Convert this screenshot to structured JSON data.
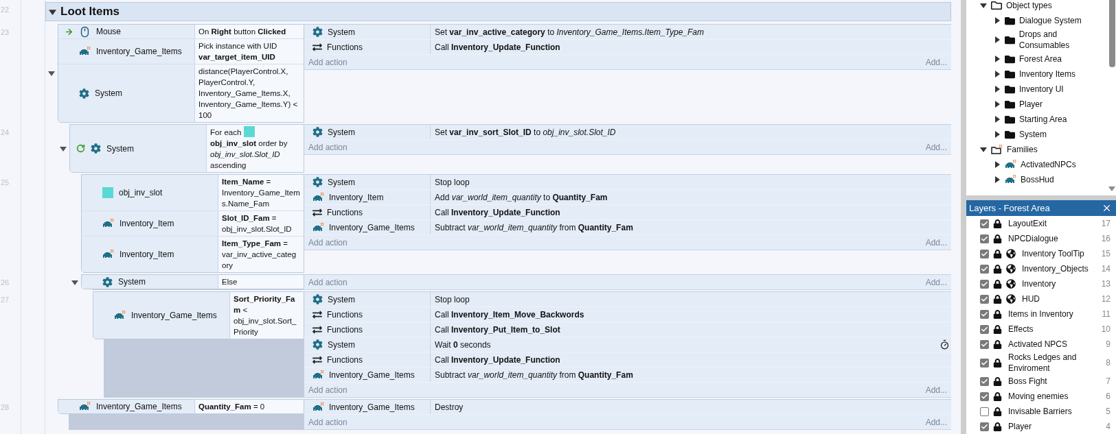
{
  "group": {
    "line": "22",
    "title": "Loot Items",
    "expanded": true,
    "events": [
      {
        "line": "23",
        "expanded": true,
        "trigger": true,
        "loop": false,
        "conditions": [
          {
            "kind": "mouse",
            "object": "Mouse",
            "text": "On **Right** button **Clicked**"
          },
          {
            "kind": "sprite",
            "object": "Inventory_Game_Items",
            "text": "Pick instance with UID **var_target_item_UID**"
          },
          {
            "kind": "system",
            "object": "System",
            "text": "distance(PlayerControl.X, PlayerControl.Y, Inventory_Game_Items.X, Inventory_Game_Items.Y) < 100"
          }
        ],
        "actions": [
          {
            "kind": "system",
            "object": "System",
            "text": "Set **var_inv_active_category** to *Inventory_Game_Items.Item_Type_Fam*"
          },
          {
            "kind": "functions",
            "object": "Functions",
            "text": "Call **Inventory_Update_Function**"
          }
        ],
        "add_action": "Add action",
        "add_more": "Add...",
        "children": [
          {
            "line": "24",
            "expanded": true,
            "trigger": false,
            "loop": true,
            "conditions": [
              {
                "kind": "foreach",
                "object": "System",
                "lead": "For each",
                "text": "**obj_inv_slot** order by *obj_inv_slot.Slot_ID* ascending"
              }
            ],
            "actions": [
              {
                "kind": "system",
                "object": "System",
                "text": "Set **var_inv_sort_Slot_ID** to *obj_inv_slot.Slot_ID*"
              }
            ],
            "add_action": "Add action",
            "add_more": "Add...",
            "children": [
              {
                "line": "25",
                "trigger": false,
                "loop": false,
                "conditions": [
                  {
                    "kind": "swatch",
                    "object": "obj_inv_slot",
                    "text": "**Item_Name** = Inventory_Game_Items.Name_Fam"
                  },
                  {
                    "kind": "sprite",
                    "object": "Inventory_Item",
                    "text": "**Slot_ID_Fam** = obj_inv_slot.Slot_ID"
                  },
                  {
                    "kind": "sprite",
                    "object": "Inventory_Item",
                    "text": "**Item_Type_Fam** = var_inv_active_category"
                  }
                ],
                "actions": [
                  {
                    "kind": "system",
                    "object": "System",
                    "text": "Stop loop"
                  },
                  {
                    "kind": "sprite",
                    "object": "Inventory_Item",
                    "text": "Add *var_world_item_quantity* to **Quantity_Fam**"
                  },
                  {
                    "kind": "functions",
                    "object": "Functions",
                    "text": "Call **Inventory_Update_Function**"
                  },
                  {
                    "kind": "sprite",
                    "object": "Inventory_Game_Items",
                    "text": "Subtract *var_world_item_quantity* from **Quantity_Fam**"
                  }
                ],
                "add_action": "Add action",
                "add_more": "Add..."
              },
              {
                "line": "26",
                "expanded": true,
                "trigger": false,
                "loop": false,
                "conditions": [
                  {
                    "kind": "system",
                    "object": "System",
                    "text": "Else"
                  }
                ],
                "add_action": "Add action",
                "add_more": "Add...",
                "children": [
                  {
                    "line": "27",
                    "trigger": false,
                    "loop": false,
                    "conditions": [
                      {
                        "kind": "sprite",
                        "object": "Inventory_Game_Items",
                        "text": "**Sort_Priority_Fam** < obj_inv_slot.Sort_Priority"
                      }
                    ],
                    "actions": [
                      {
                        "kind": "system",
                        "object": "System",
                        "text": "Stop loop"
                      },
                      {
                        "kind": "functions",
                        "object": "Functions",
                        "text": "Call **Inventory_Item_Move_Backwords**"
                      },
                      {
                        "kind": "functions",
                        "object": "Functions",
                        "text": "Call **Inventory_Put_Item_to_Slot**"
                      },
                      {
                        "kind": "wait",
                        "object": "System",
                        "text": "Wait **0** seconds"
                      },
                      {
                        "kind": "functions",
                        "object": "Functions",
                        "text": "Call **Inventory_Update_Function**"
                      },
                      {
                        "kind": "sprite",
                        "object": "Inventory_Game_Items",
                        "text": "Subtract *var_world_item_quantity* from **Quantity_Fam**"
                      }
                    ],
                    "add_action": "Add action",
                    "add_more": "Add..."
                  }
                ]
              }
            ]
          }
        ]
      },
      {
        "line": "28",
        "trigger": false,
        "loop": false,
        "conditions": [
          {
            "kind": "sprite",
            "object": "Inventory_Game_Items",
            "text": "**Quantity_Fam** = 0"
          }
        ],
        "actions": [
          {
            "kind": "sprite",
            "object": "Inventory_Game_Items",
            "text": "Destroy"
          }
        ],
        "add_action": "Add action",
        "add_more": "Add..."
      }
    ]
  },
  "project_tree": [
    {
      "label": "Object types",
      "kind": "folder",
      "expanded": true,
      "children": [
        {
          "label": "Dialogue System",
          "kind": "subfolder",
          "expanded": false
        },
        {
          "label": "Drops and Consumables",
          "kind": "subfolder",
          "expanded": false
        },
        {
          "label": "Forest Area",
          "kind": "subfolder",
          "expanded": false
        },
        {
          "label": "Inventory Items",
          "kind": "subfolder",
          "expanded": false
        },
        {
          "label": "Inventory UI",
          "kind": "subfolder",
          "expanded": false
        },
        {
          "label": "Player",
          "kind": "subfolder",
          "expanded": false
        },
        {
          "label": "Starting Area",
          "kind": "subfolder",
          "expanded": false
        },
        {
          "label": "System",
          "kind": "subfolder",
          "expanded": false
        }
      ]
    },
    {
      "label": "Families",
      "kind": "families",
      "expanded": true,
      "children": [
        {
          "label": "ActivatedNPCs",
          "kind": "family",
          "expanded": false
        },
        {
          "label": "BossHud",
          "kind": "family",
          "expanded": false
        }
      ]
    }
  ],
  "layers_panel": {
    "title": "Layers - Forest Area",
    "layers": [
      {
        "name": "LayoutExit",
        "number": "17",
        "visible": true,
        "locked": true,
        "global": false
      },
      {
        "name": "NPCDialogue",
        "number": "16",
        "visible": true,
        "locked": true,
        "global": false
      },
      {
        "name": "Inventory ToolTip",
        "number": "15",
        "visible": true,
        "locked": true,
        "global": true
      },
      {
        "name": "Inventory_Objects",
        "number": "14",
        "visible": true,
        "locked": true,
        "global": true
      },
      {
        "name": "Inventory",
        "number": "13",
        "visible": true,
        "locked": true,
        "global": true
      },
      {
        "name": "HUD",
        "number": "12",
        "visible": true,
        "locked": true,
        "global": true
      },
      {
        "name": "Items in Inventory",
        "number": "11",
        "visible": true,
        "locked": true,
        "global": false
      },
      {
        "name": "Effects",
        "number": "10",
        "visible": true,
        "locked": true,
        "global": false
      },
      {
        "name": "Activated NPCS",
        "number": "9",
        "visible": true,
        "locked": true,
        "global": false
      },
      {
        "name": "Rocks Ledges and Enviroment",
        "number": "8",
        "visible": true,
        "locked": true,
        "global": false
      },
      {
        "name": "Boss Fight",
        "number": "7",
        "visible": true,
        "locked": true,
        "global": false
      },
      {
        "name": "Moving enemies",
        "number": "6",
        "visible": true,
        "locked": true,
        "global": false
      },
      {
        "name": "Invisable Barriers",
        "number": "5",
        "visible": false,
        "locked": true,
        "global": false
      },
      {
        "name": "Player",
        "number": "4",
        "visible": true,
        "locked": true,
        "global": false
      }
    ]
  }
}
